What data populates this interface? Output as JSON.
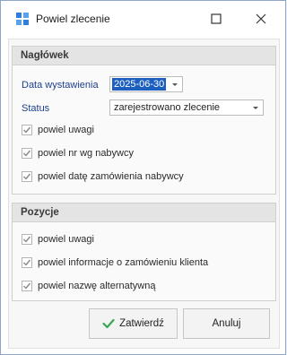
{
  "window": {
    "title": "Powiel zlecenie",
    "app_icon": "app-grid-icon",
    "maximize_icon": "maximize-icon",
    "close_icon": "close-icon"
  },
  "naglowek": {
    "title": "Nagłówek",
    "date_label": "Data wystawienia",
    "date_value": "2025-06-30",
    "status_label": "Status",
    "status_value": "zarejestrowano zlecenie",
    "checkboxes": [
      {
        "label": "powiel uwagi",
        "checked": true
      },
      {
        "label": "powiel nr wg nabywcy",
        "checked": true
      },
      {
        "label": "powiel datę zamówienia nabywcy",
        "checked": true
      }
    ]
  },
  "pozycje": {
    "title": "Pozycje",
    "checkboxes": [
      {
        "label": "powiel uwagi",
        "checked": true
      },
      {
        "label": "powiel informacje o zamówieniu klienta",
        "checked": true
      },
      {
        "label": "powiel nazwę alternatywną",
        "checked": true
      }
    ]
  },
  "buttons": {
    "confirm_label": "Zatwierdź",
    "cancel_label": "Anuluj"
  },
  "colors": {
    "accent_label": "#1d3f8f",
    "selection": "#1c5fbf",
    "check_green": "#3aa655"
  }
}
